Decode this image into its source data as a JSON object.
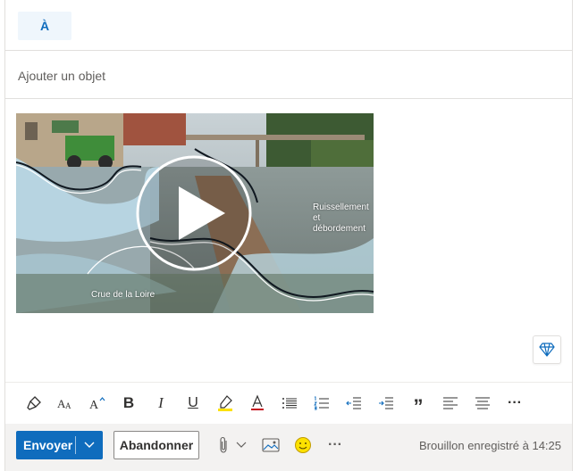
{
  "recipients": {
    "to_label": "À"
  },
  "subject": {
    "placeholder": "Ajouter un objet"
  },
  "body": {
    "video": {
      "caption_right": "Ruissellement et débordement",
      "caption_left": "Crue de la Loire"
    }
  },
  "formatting_toolbar": {
    "items": [
      "format-painter",
      "font-size",
      "grow-font",
      "bold",
      "italic",
      "underline",
      "highlight",
      "font-color",
      "bullets",
      "numbering",
      "decrease-indent",
      "increase-indent",
      "quote",
      "align-left",
      "align-center",
      "more"
    ],
    "bold_glyph": "B",
    "italic_glyph": "I",
    "underline_glyph": "U",
    "quote_glyph": "”",
    "more_glyph": "···"
  },
  "actions": {
    "send_label": "Envoyer",
    "discard_label": "Abandonner",
    "more_glyph": "···",
    "draft_status": "Brouillon enregistré à 14:25"
  },
  "colors": {
    "accent": "#0f6cbd",
    "to_bg": "#eff6fc",
    "action_bar_bg": "#f3f2f1",
    "highlight": "#fce100",
    "font_color_underline": "#c50f1f"
  }
}
